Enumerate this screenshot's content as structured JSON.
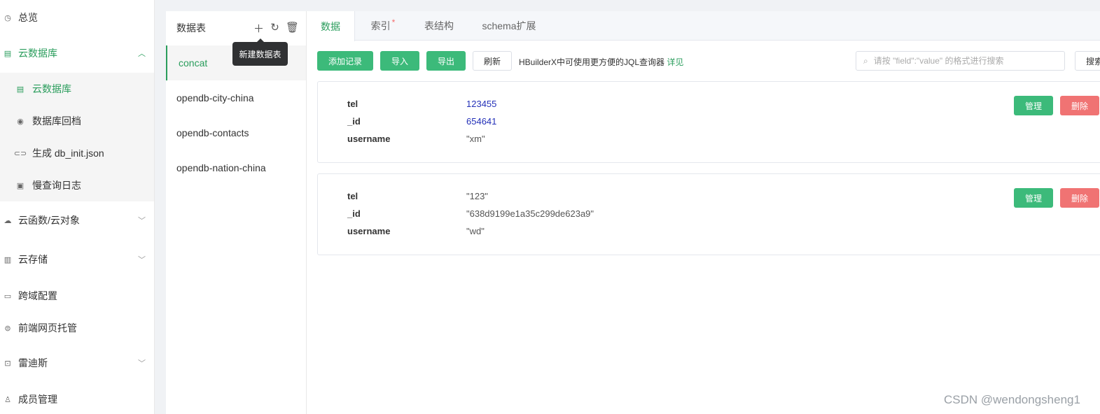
{
  "nav": {
    "overview": {
      "label": "总览",
      "icon": "clock-icon"
    },
    "clouddb": {
      "label": "云数据库",
      "icon": "database-icon"
    },
    "sub": [
      {
        "label": "云数据库",
        "icon": "table-icon"
      },
      {
        "label": "数据库回档",
        "icon": "restore-icon"
      },
      {
        "label": "生成 db_init.json",
        "icon": "link-icon"
      },
      {
        "label": "慢查询日志",
        "icon": "log-icon"
      }
    ],
    "functions": {
      "label": "云函数/云对象",
      "icon": "cloud-icon"
    },
    "storage": {
      "label": "云存储",
      "icon": "storage-icon"
    },
    "cors": {
      "label": "跨域配置",
      "icon": "cors-icon"
    },
    "hosting": {
      "label": "前端网页托管",
      "icon": "web-icon"
    },
    "redis": {
      "label": "雷迪斯",
      "icon": "redis-icon"
    },
    "members": {
      "label": "成员管理",
      "icon": "user-icon"
    }
  },
  "tables": {
    "title": "数据表",
    "tooltip": "新建数据表",
    "items": [
      "concat",
      "opendb-city-china",
      "opendb-contacts",
      "opendb-nation-china"
    ]
  },
  "tabs": {
    "data": "数据",
    "index": "索引",
    "index_mark": "*",
    "schema": "表结构",
    "schema_ext": "schema扩展"
  },
  "toolbar": {
    "add": "添加记录",
    "import": "导入",
    "export": "导出",
    "refresh": "刷新",
    "hint": "HBuilderX中可使用更方便的JQL查询器",
    "hint_link": "详见",
    "search_placeholder": "请按 \"field\":\"value\" 的格式进行搜索",
    "search_btn": "搜索"
  },
  "records": [
    {
      "fields": [
        {
          "key": "tel",
          "value": "123455"
        },
        {
          "key": "_id",
          "value": "654641"
        },
        {
          "key": "username",
          "value": "\"xm\""
        }
      ]
    },
    {
      "fields": [
        {
          "key": "tel",
          "value": "\"123\""
        },
        {
          "key": "_id",
          "value": "\"638d9199e1a35c299de623a9\""
        },
        {
          "key": "username",
          "value": "\"wd\""
        }
      ]
    }
  ],
  "record_actions": {
    "manage": "管理",
    "delete": "删除"
  },
  "watermark": "CSDN @wendongsheng1",
  "colors": {
    "accent": "#2a9d5c",
    "button_green": "#3cba7a",
    "button_red": "#f07373",
    "number": "#2330b8"
  }
}
